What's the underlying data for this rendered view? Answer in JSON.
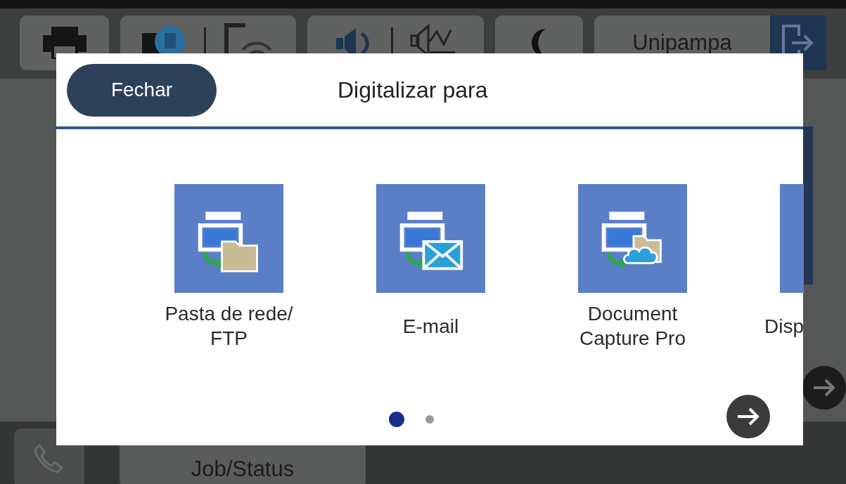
{
  "status_bar": {
    "user": "Unipampa"
  },
  "dialog": {
    "close_button": "Fechar",
    "title": "Digitalizar para",
    "destinations": [
      {
        "kind": "folder",
        "label": "Pasta de rede/ FTP"
      },
      {
        "kind": "email",
        "label": "E-mail"
      },
      {
        "kind": "cloud",
        "label": "Document Capture Pro"
      },
      {
        "kind": "partial",
        "label": "Disp"
      }
    ],
    "pages": [
      {
        "selected": true
      },
      {
        "selected": false
      }
    ]
  },
  "bottom_bar": {
    "job_button": "Job/Status"
  }
}
